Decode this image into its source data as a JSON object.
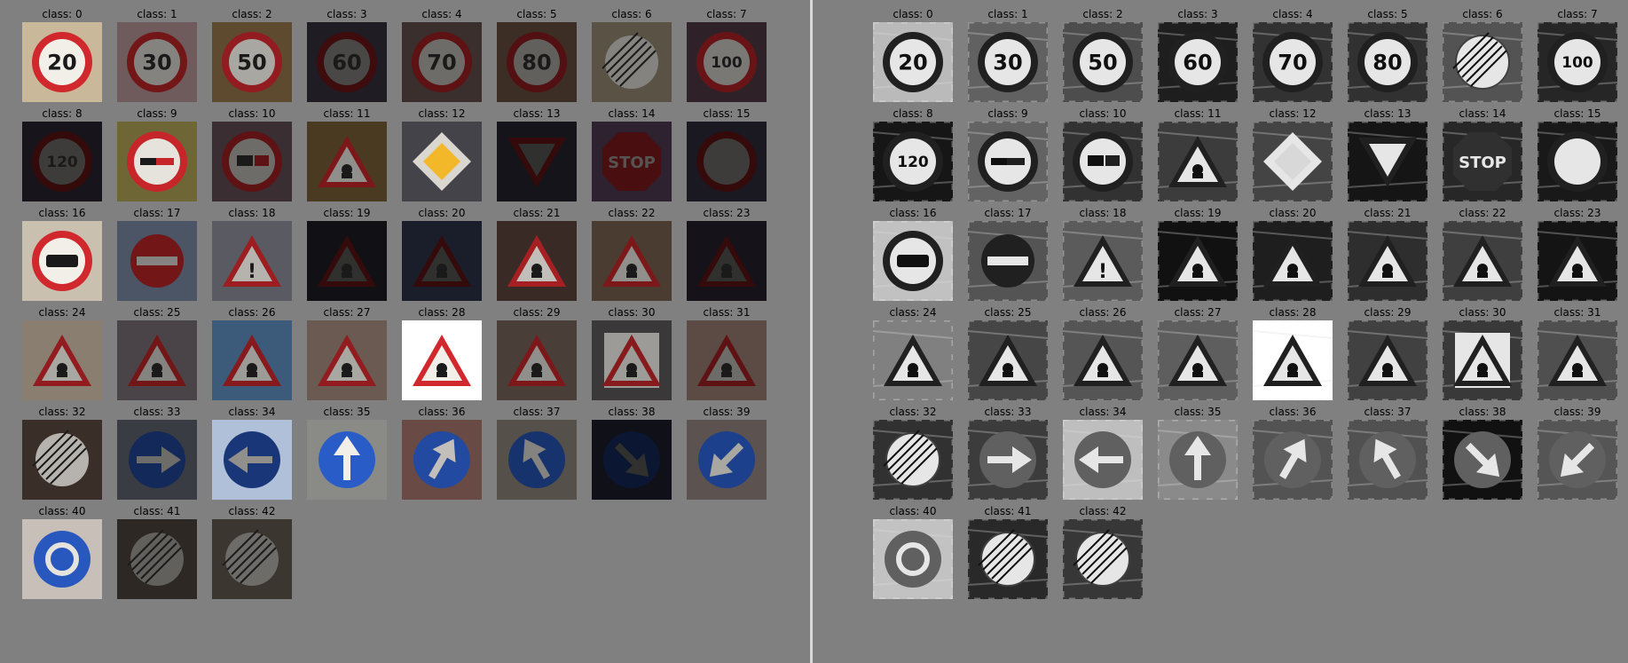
{
  "caption_prefix": "class: ",
  "panels": [
    {
      "id": "left",
      "style": "color"
    },
    {
      "id": "right",
      "style": "grayscale"
    }
  ],
  "classes": [
    {
      "id": 0,
      "sign": "speed-limit",
      "text": "20",
      "bg": "#c9b89a",
      "bright": 1.0
    },
    {
      "id": 1,
      "sign": "speed-limit",
      "text": "30",
      "bg": "#6f5a5c",
      "bright": 0.55
    },
    {
      "id": 2,
      "sign": "speed-limit",
      "text": "50",
      "bg": "#5e4a2e",
      "bright": 0.7
    },
    {
      "id": 3,
      "sign": "speed-limit",
      "text": "60",
      "bg": "#1f1c24",
      "bright": 0.3
    },
    {
      "id": 4,
      "sign": "speed-limit",
      "text": "70",
      "bg": "#3a2f2c",
      "bright": 0.45
    },
    {
      "id": 5,
      "sign": "speed-limit",
      "text": "80",
      "bg": "#3c2e25",
      "bright": 0.4
    },
    {
      "id": 6,
      "sign": "end-speed-limit",
      "text": "",
      "bg": "#5a5245",
      "bright": 0.55
    },
    {
      "id": 7,
      "sign": "speed-limit",
      "text": "100",
      "bg": "#2e2228",
      "bright": 0.5
    },
    {
      "id": 8,
      "sign": "speed-limit",
      "text": "120",
      "bg": "#17151b",
      "bright": 0.25
    },
    {
      "id": 9,
      "sign": "no-passing",
      "text": "",
      "bg": "#6f6636",
      "bright": 0.95
    },
    {
      "id": 10,
      "sign": "no-passing-trucks",
      "text": "",
      "bg": "#3a2e33",
      "bright": 0.45
    },
    {
      "id": 11,
      "sign": "warning-triangle",
      "text": "",
      "bg": "#4a3a22",
      "bright": 0.6
    },
    {
      "id": 12,
      "sign": "priority-road",
      "text": "",
      "bg": "#45434a",
      "bright": 0.9
    },
    {
      "id": 13,
      "sign": "yield",
      "text": "",
      "bg": "#14141a",
      "bright": 0.15
    },
    {
      "id": 14,
      "sign": "stop",
      "text": "STOP",
      "bg": "#2e2230",
      "bright": 0.35
    },
    {
      "id": 15,
      "sign": "no-vehicles",
      "text": "",
      "bg": "#1a1820",
      "bright": 0.25
    },
    {
      "id": 16,
      "sign": "no-trucks",
      "text": "",
      "bg": "#c9c0b0",
      "bright": 1.0
    },
    {
      "id": 17,
      "sign": "no-entry",
      "text": "",
      "bg": "#4b5566",
      "bright": 0.55
    },
    {
      "id": 18,
      "sign": "warning-triangle",
      "text": "!",
      "bg": "#5a5a62",
      "bright": 0.75
    },
    {
      "id": 19,
      "sign": "warning-triangle",
      "text": "",
      "bg": "#111015",
      "bright": 0.1
    },
    {
      "id": 20,
      "sign": "warning-triangle",
      "text": "",
      "bg": "#1a1d2a",
      "bright": 0.2
    },
    {
      "id": 21,
      "sign": "warning-triangle",
      "text": "",
      "bg": "#3a2a25",
      "bright": 0.8
    },
    {
      "id": 22,
      "sign": "warning-triangle",
      "text": "",
      "bg": "#4a3c30",
      "bright": 0.6
    },
    {
      "id": 23,
      "sign": "warning-triangle",
      "text": "",
      "bg": "#15121a",
      "bright": 0.15
    },
    {
      "id": 24,
      "sign": "warning-triangle",
      "text": "",
      "bg": "#8a7e70",
      "bright": 0.7
    },
    {
      "id": 25,
      "sign": "warning-triangle",
      "text": "",
      "bg": "#4a4448",
      "bright": 0.55
    },
    {
      "id": 26,
      "sign": "warning-triangle",
      "text": "",
      "bg": "#3c5b7a",
      "bright": 0.65
    },
    {
      "id": 27,
      "sign": "warning-triangle",
      "text": "",
      "bg": "#6a5a52",
      "bright": 0.7
    },
    {
      "id": 28,
      "sign": "warning-triangle",
      "text": "",
      "bg": "#ffffff",
      "bright": 1.0
    },
    {
      "id": 29,
      "sign": "warning-triangle",
      "text": "",
      "bg": "#4a3e38",
      "bright": 0.6
    },
    {
      "id": 30,
      "sign": "warning-square",
      "text": "",
      "bg": "#3a3838",
      "bright": 0.65
    },
    {
      "id": 31,
      "sign": "warning-triangle",
      "text": "",
      "bg": "#5c4a44",
      "bright": 0.45
    },
    {
      "id": 32,
      "sign": "end-restriction",
      "text": "",
      "bg": "#3a2e28",
      "bright": 0.75
    },
    {
      "id": 33,
      "sign": "blue-arrow-right",
      "text": "",
      "bg": "#3a3c44",
      "bright": 0.45
    },
    {
      "id": 34,
      "sign": "blue-arrow-left",
      "text": "",
      "bg": "#b0c0d8",
      "bright": 0.6
    },
    {
      "id": 35,
      "sign": "blue-arrow-up",
      "text": "",
      "bg": "#8a8a86",
      "bright": 1.0
    },
    {
      "id": 36,
      "sign": "blue-arrow-up-right",
      "text": "",
      "bg": "#6a4a44",
      "bright": 0.8
    },
    {
      "id": 37,
      "sign": "blue-arrow-up-left",
      "text": "",
      "bg": "#55504a",
      "bright": 0.55
    },
    {
      "id": 38,
      "sign": "blue-arrow-down-right",
      "text": "",
      "bg": "#101018",
      "bright": 0.1
    },
    {
      "id": 39,
      "sign": "blue-arrow-down-left",
      "text": "",
      "bg": "#5c5250",
      "bright": 0.7
    },
    {
      "id": 40,
      "sign": "roundabout",
      "text": "",
      "bg": "#c8c0b8",
      "bright": 0.95
    },
    {
      "id": 41,
      "sign": "end-no-passing",
      "text": "",
      "bg": "#2e2824",
      "bright": 0.4
    },
    {
      "id": 42,
      "sign": "end-no-passing-trucks",
      "text": "",
      "bg": "#3c3630",
      "bright": 0.45
    }
  ]
}
